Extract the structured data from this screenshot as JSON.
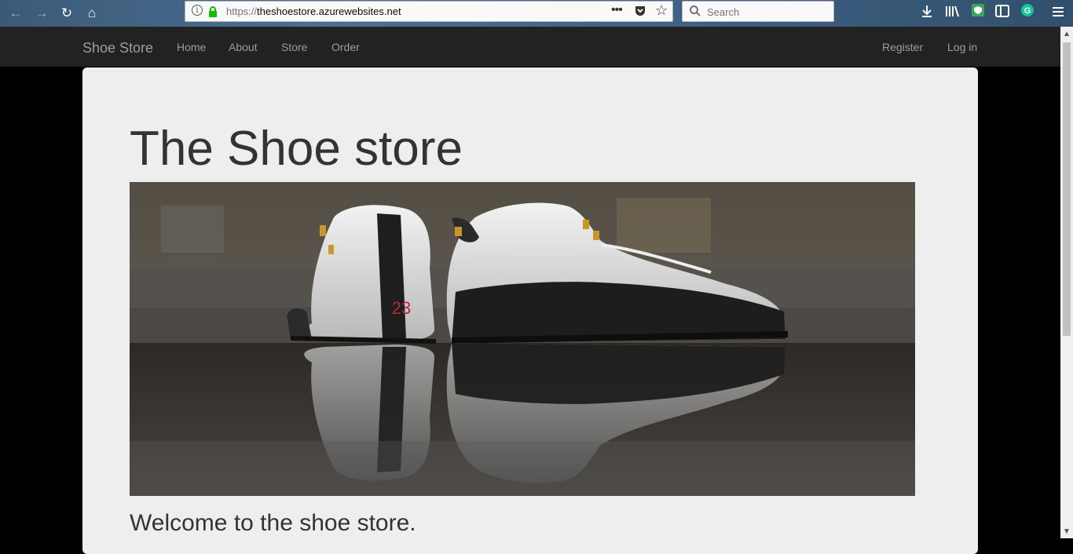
{
  "browser": {
    "url_protocol": "https://",
    "url_host": "theshoestore.azurewebsites.net",
    "search_placeholder": "Search",
    "icons": [
      "back-icon",
      "forward-icon",
      "reload-icon",
      "home-icon",
      "info-icon",
      "lock-icon",
      "more-icon",
      "pocket-icon",
      "bookmark-star-icon",
      "search-icon",
      "download-icon",
      "library-icon",
      "extension-shield-icon",
      "sidebar-icon",
      "grammarly-icon",
      "menu-icon"
    ]
  },
  "navbar": {
    "brand": "Shoe Store",
    "links": [
      "Home",
      "About",
      "Store",
      "Order"
    ],
    "right_links": [
      "Register",
      "Log in"
    ]
  },
  "main": {
    "title": "The Shoe store",
    "hero_shoe_number": "23",
    "welcome": "Welcome to the shoe store."
  },
  "colors": {
    "navbar_bg": "#222222",
    "nav_text": "#9d9d9d",
    "jumbotron_bg": "#eeeeee",
    "body_bg": "#000000"
  }
}
